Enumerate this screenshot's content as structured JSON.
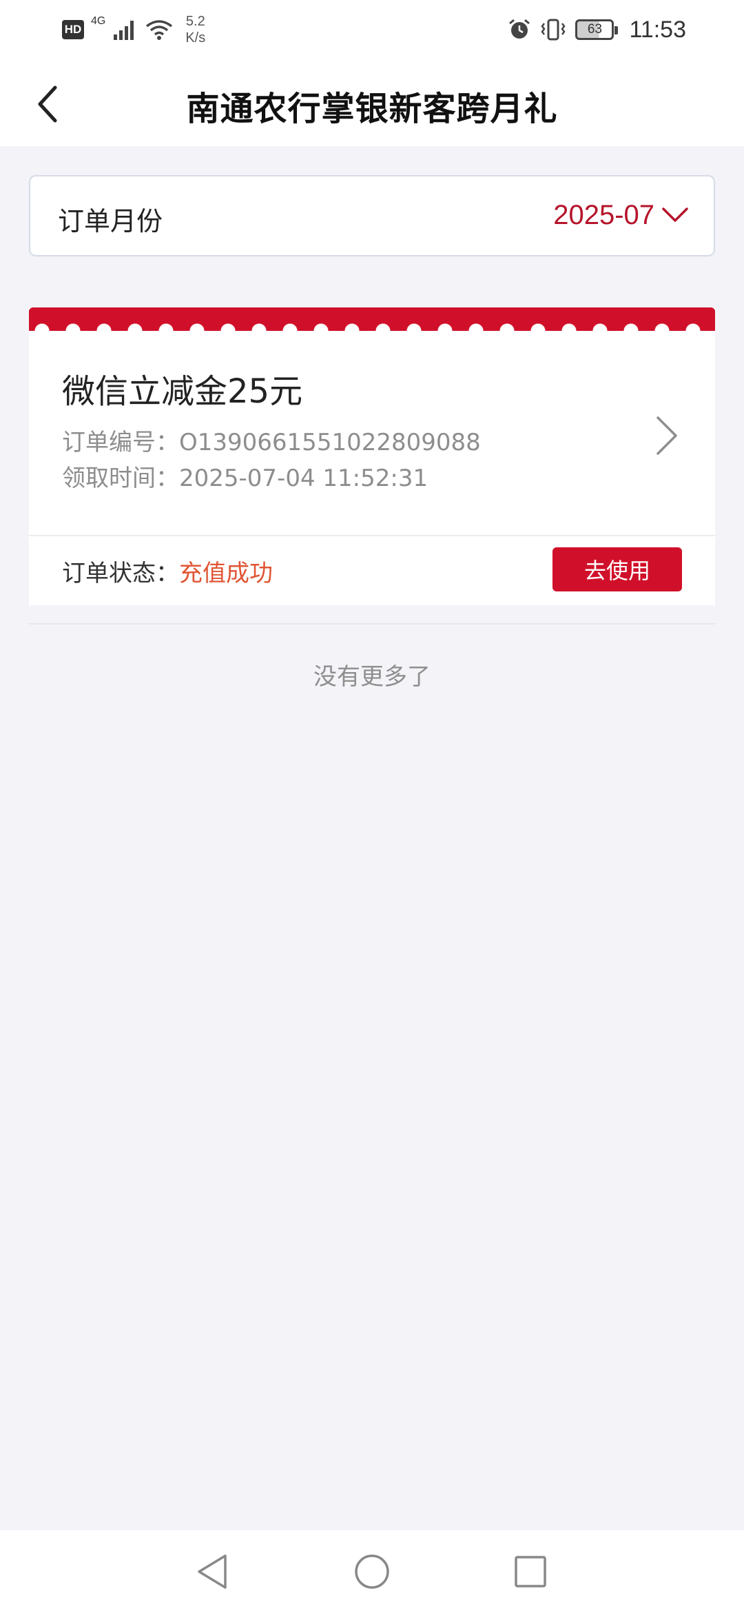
{
  "status_bar": {
    "hd": "HD",
    "network": "4G",
    "speed_value": "5.2",
    "speed_unit": "K/s",
    "battery": "63",
    "time": "11:53",
    "icons": [
      "signal-icon",
      "wifi-icon",
      "alarm-icon",
      "vibrate-icon",
      "battery-icon"
    ]
  },
  "header": {
    "title": "南通农行掌银新客跨月礼",
    "back_icon": "chevron-left-icon"
  },
  "month_filter": {
    "label": "订单月份",
    "value": "2025-07",
    "dropdown_icon": "chevron-down-icon"
  },
  "orders": [
    {
      "product": "微信立减金25元",
      "order_no_label": "订单编号：",
      "order_no": "O1390661551022809088",
      "time_label": "领取时间：",
      "time": "2025-07-04 11:52:31",
      "status_label": "订单状态：",
      "status": "充值成功",
      "action": "去使用"
    }
  ],
  "list_end": "没有更多了",
  "colors": {
    "accent_red": "#d0102a",
    "month_value": "#b5142b",
    "status_success": "#e05534",
    "background": "#f3f3f8"
  },
  "nav_bar": {
    "icons": [
      "nav-back-icon",
      "nav-home-icon",
      "nav-recent-icon"
    ]
  }
}
